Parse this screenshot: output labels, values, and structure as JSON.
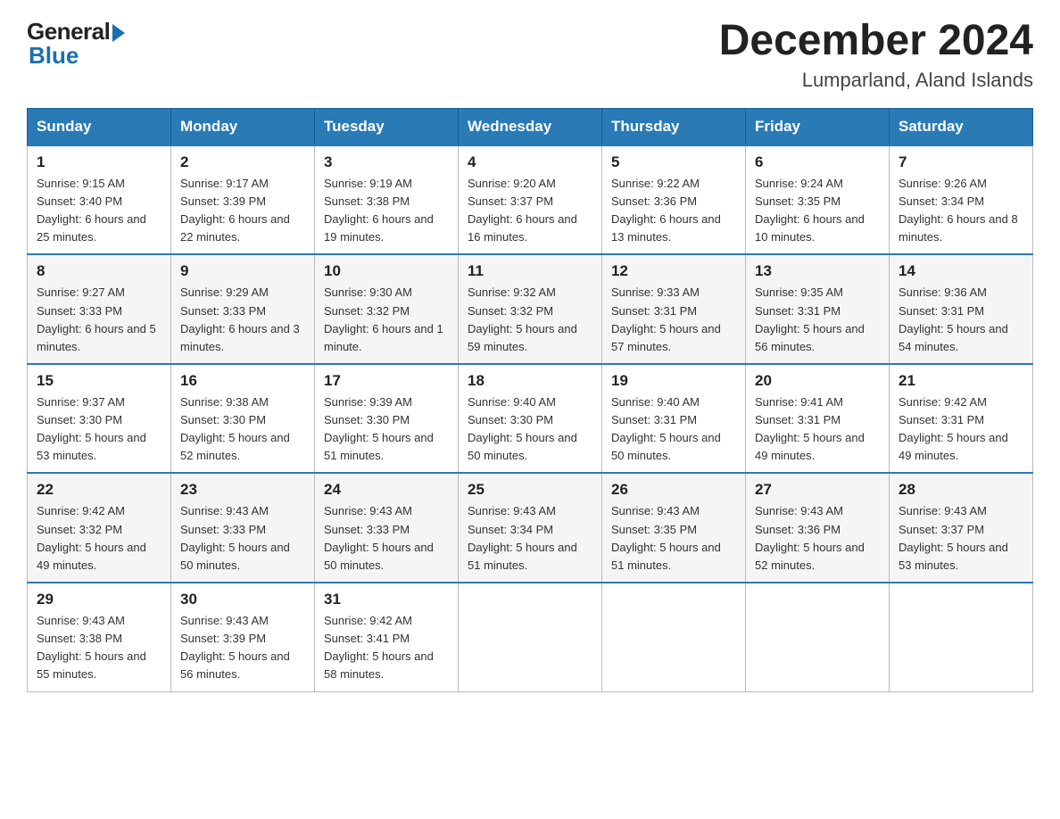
{
  "logo": {
    "general": "General",
    "blue": "Blue"
  },
  "title": "December 2024",
  "subtitle": "Lumparland, Aland Islands",
  "days": [
    "Sunday",
    "Monday",
    "Tuesday",
    "Wednesday",
    "Thursday",
    "Friday",
    "Saturday"
  ],
  "weeks": [
    [
      {
        "num": "1",
        "sunrise": "9:15 AM",
        "sunset": "3:40 PM",
        "daylight": "6 hours and 25 minutes."
      },
      {
        "num": "2",
        "sunrise": "9:17 AM",
        "sunset": "3:39 PM",
        "daylight": "6 hours and 22 minutes."
      },
      {
        "num": "3",
        "sunrise": "9:19 AM",
        "sunset": "3:38 PM",
        "daylight": "6 hours and 19 minutes."
      },
      {
        "num": "4",
        "sunrise": "9:20 AM",
        "sunset": "3:37 PM",
        "daylight": "6 hours and 16 minutes."
      },
      {
        "num": "5",
        "sunrise": "9:22 AM",
        "sunset": "3:36 PM",
        "daylight": "6 hours and 13 minutes."
      },
      {
        "num": "6",
        "sunrise": "9:24 AM",
        "sunset": "3:35 PM",
        "daylight": "6 hours and 10 minutes."
      },
      {
        "num": "7",
        "sunrise": "9:26 AM",
        "sunset": "3:34 PM",
        "daylight": "6 hours and 8 minutes."
      }
    ],
    [
      {
        "num": "8",
        "sunrise": "9:27 AM",
        "sunset": "3:33 PM",
        "daylight": "6 hours and 5 minutes."
      },
      {
        "num": "9",
        "sunrise": "9:29 AM",
        "sunset": "3:33 PM",
        "daylight": "6 hours and 3 minutes."
      },
      {
        "num": "10",
        "sunrise": "9:30 AM",
        "sunset": "3:32 PM",
        "daylight": "6 hours and 1 minute."
      },
      {
        "num": "11",
        "sunrise": "9:32 AM",
        "sunset": "3:32 PM",
        "daylight": "5 hours and 59 minutes."
      },
      {
        "num": "12",
        "sunrise": "9:33 AM",
        "sunset": "3:31 PM",
        "daylight": "5 hours and 57 minutes."
      },
      {
        "num": "13",
        "sunrise": "9:35 AM",
        "sunset": "3:31 PM",
        "daylight": "5 hours and 56 minutes."
      },
      {
        "num": "14",
        "sunrise": "9:36 AM",
        "sunset": "3:31 PM",
        "daylight": "5 hours and 54 minutes."
      }
    ],
    [
      {
        "num": "15",
        "sunrise": "9:37 AM",
        "sunset": "3:30 PM",
        "daylight": "5 hours and 53 minutes."
      },
      {
        "num": "16",
        "sunrise": "9:38 AM",
        "sunset": "3:30 PM",
        "daylight": "5 hours and 52 minutes."
      },
      {
        "num": "17",
        "sunrise": "9:39 AM",
        "sunset": "3:30 PM",
        "daylight": "5 hours and 51 minutes."
      },
      {
        "num": "18",
        "sunrise": "9:40 AM",
        "sunset": "3:30 PM",
        "daylight": "5 hours and 50 minutes."
      },
      {
        "num": "19",
        "sunrise": "9:40 AM",
        "sunset": "3:31 PM",
        "daylight": "5 hours and 50 minutes."
      },
      {
        "num": "20",
        "sunrise": "9:41 AM",
        "sunset": "3:31 PM",
        "daylight": "5 hours and 49 minutes."
      },
      {
        "num": "21",
        "sunrise": "9:42 AM",
        "sunset": "3:31 PM",
        "daylight": "5 hours and 49 minutes."
      }
    ],
    [
      {
        "num": "22",
        "sunrise": "9:42 AM",
        "sunset": "3:32 PM",
        "daylight": "5 hours and 49 minutes."
      },
      {
        "num": "23",
        "sunrise": "9:43 AM",
        "sunset": "3:33 PM",
        "daylight": "5 hours and 50 minutes."
      },
      {
        "num": "24",
        "sunrise": "9:43 AM",
        "sunset": "3:33 PM",
        "daylight": "5 hours and 50 minutes."
      },
      {
        "num": "25",
        "sunrise": "9:43 AM",
        "sunset": "3:34 PM",
        "daylight": "5 hours and 51 minutes."
      },
      {
        "num": "26",
        "sunrise": "9:43 AM",
        "sunset": "3:35 PM",
        "daylight": "5 hours and 51 minutes."
      },
      {
        "num": "27",
        "sunrise": "9:43 AM",
        "sunset": "3:36 PM",
        "daylight": "5 hours and 52 minutes."
      },
      {
        "num": "28",
        "sunrise": "9:43 AM",
        "sunset": "3:37 PM",
        "daylight": "5 hours and 53 minutes."
      }
    ],
    [
      {
        "num": "29",
        "sunrise": "9:43 AM",
        "sunset": "3:38 PM",
        "daylight": "5 hours and 55 minutes."
      },
      {
        "num": "30",
        "sunrise": "9:43 AM",
        "sunset": "3:39 PM",
        "daylight": "5 hours and 56 minutes."
      },
      {
        "num": "31",
        "sunrise": "9:42 AM",
        "sunset": "3:41 PM",
        "daylight": "5 hours and 58 minutes."
      },
      null,
      null,
      null,
      null
    ]
  ],
  "labels": {
    "sunrise": "Sunrise:",
    "sunset": "Sunset:",
    "daylight": "Daylight:"
  }
}
